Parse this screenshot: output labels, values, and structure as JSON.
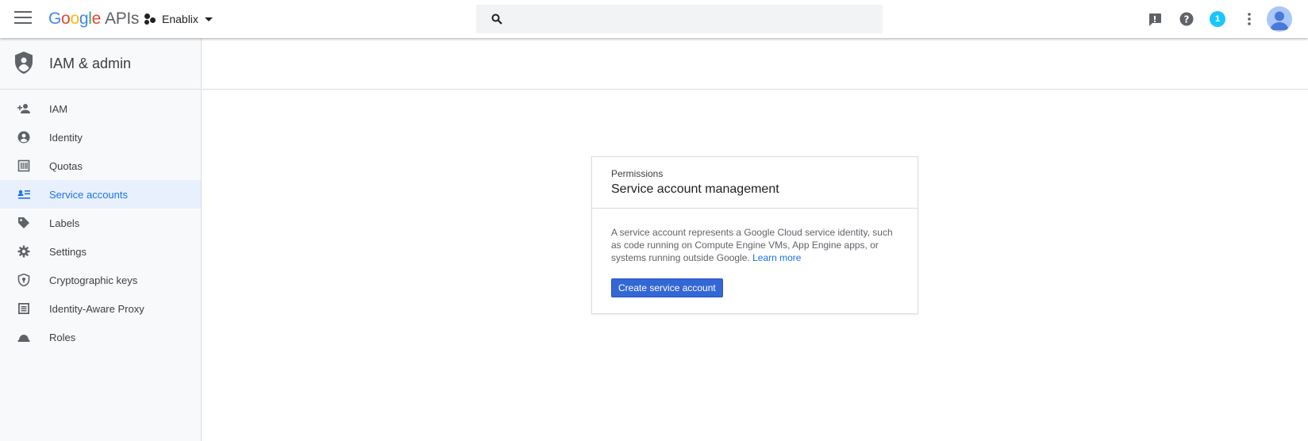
{
  "header": {
    "brand": {
      "google": [
        "G",
        "o",
        "o",
        "g",
        "l",
        "e"
      ],
      "apis": "APIs"
    },
    "project_name": "Enablix",
    "search": {
      "value": "",
      "placeholder": ""
    },
    "notification_count": "1"
  },
  "sidebar": {
    "title": "IAM & admin",
    "items": [
      {
        "label": "IAM",
        "icon": "person-add-icon"
      },
      {
        "label": "Identity",
        "icon": "account-circle-icon"
      },
      {
        "label": "Quotas",
        "icon": "quotas-icon"
      },
      {
        "label": "Service accounts",
        "icon": "service-account-icon",
        "active": true
      },
      {
        "label": "Labels",
        "icon": "label-icon"
      },
      {
        "label": "Settings",
        "icon": "gear-icon"
      },
      {
        "label": "Cryptographic keys",
        "icon": "security-shield-icon"
      },
      {
        "label": "Identity-Aware Proxy",
        "icon": "proxy-icon"
      },
      {
        "label": "Roles",
        "icon": "roles-icon"
      }
    ]
  },
  "card": {
    "overline": "Permissions",
    "title": "Service account management",
    "description_line1": "A service account represents a Google Cloud service identity, such",
    "description_line2": "as code running on Compute Engine VMs, App Engine apps, or",
    "description_line3": "systems running outside Google.",
    "learn_more": "Learn more",
    "button_label": "Create service account"
  },
  "colors": {
    "accent": "#1a73e8",
    "button": "#3367d6",
    "active_bg": "#e8f0fe",
    "notification": "#1ac6ff"
  }
}
